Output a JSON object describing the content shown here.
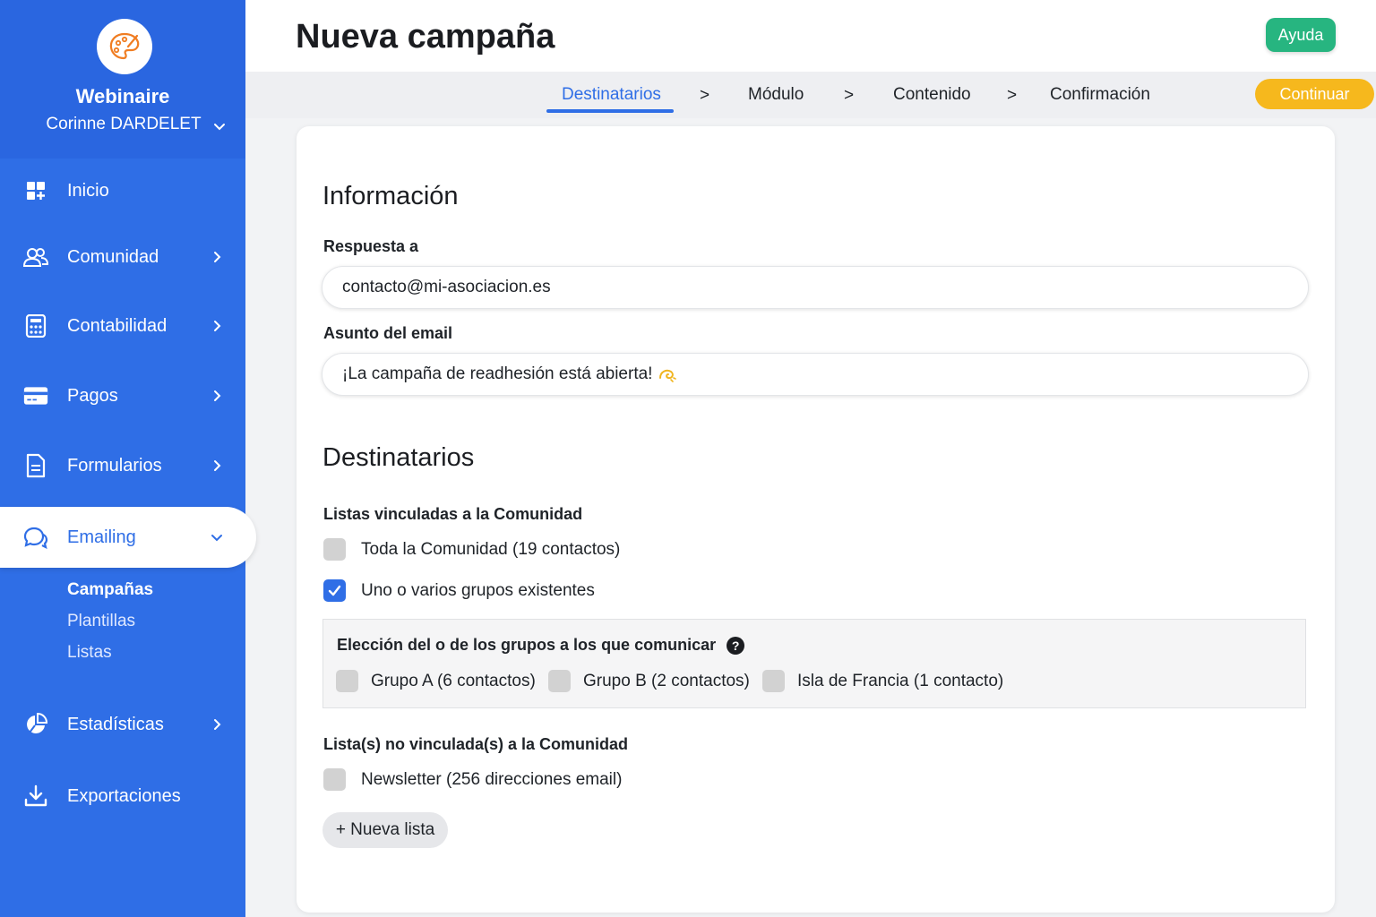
{
  "app": {
    "org_name": "Webinaire",
    "user_name": "Corinne DARDELET",
    "colors": {
      "primary": "#2f6ee6",
      "help": "#27b580",
      "continue": "#f6b81d",
      "logo_accent": "#f07d22"
    }
  },
  "sidebar": {
    "items": [
      {
        "label": "Inicio",
        "icon": "dashboard-icon"
      },
      {
        "label": "Comunidad",
        "icon": "users-icon"
      },
      {
        "label": "Contabilidad",
        "icon": "calculator-icon"
      },
      {
        "label": "Pagos",
        "icon": "credit-card-icon"
      },
      {
        "label": "Formularios",
        "icon": "document-icon"
      },
      {
        "label": "Emailing",
        "icon": "chat-icon"
      },
      {
        "label": "Estadísticas",
        "icon": "pie-chart-icon"
      },
      {
        "label": "Exportaciones",
        "icon": "download-icon"
      }
    ],
    "emailing_sub": [
      "Campañas",
      "Plantillas",
      "Listas"
    ]
  },
  "header": {
    "title": "Nueva campaña",
    "help_label": "Ayuda"
  },
  "steps": {
    "items": [
      "Destinatarios",
      "Módulo",
      "Contenido",
      "Confirmación"
    ],
    "separator": ">",
    "continue_label": "Continuar"
  },
  "form": {
    "info_title": "Información",
    "reply_label": "Respuesta a",
    "reply_value": "contacto@mi-asociacion.es",
    "subject_label": "Asunto del email",
    "subject_value": "¡La campaña de readhesión está abierta!",
    "recipients_title": "Destinatarios",
    "linked_label": "Listas vinculadas a la Comunidad",
    "opt_all": "Toda la Comunidad (19 contactos)",
    "opt_groups": "Uno o varios grupos existentes",
    "group_choice_title": "Elección del o de los grupos a los que comunicar",
    "groups": [
      "Grupo A (6 contactos)",
      "Grupo B (2 contactos)",
      "Isla de Francia (1 contacto)"
    ],
    "unlinked_label": "Lista(s) no vinculada(s) a la Comunidad",
    "newsletter": "Newsletter (256 direcciones email)",
    "new_list_label": "+ Nueva lista"
  }
}
